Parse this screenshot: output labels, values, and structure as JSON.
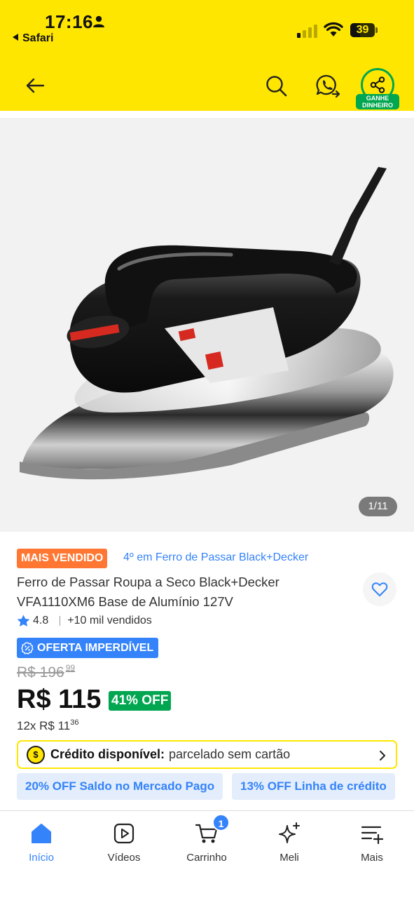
{
  "status_bar": {
    "time": "17:16",
    "back_app": "Safari",
    "battery": 39
  },
  "header": {
    "back_icon": "arrow-left-icon",
    "search_icon": "search-icon",
    "whatsapp_icon": "whatsapp-share-icon",
    "share_icon": "share-icon",
    "share_tag": "GANHE DINHEIRO"
  },
  "gallery": {
    "counter": "1/11"
  },
  "product": {
    "best_seller_badge": "MAIS VENDIDO",
    "ranking_link": "4º em Ferro de Passar Black+Decker",
    "title": "Ferro de Passar Roupa a Seco Black+Decker VFA1110XM6 Base de Alumínio 127V",
    "rating": "4.8",
    "sold": "+10 mil vendidos",
    "deal_badge": "OFERTA IMPERDÍVEL",
    "old_price_main": "R$ 196",
    "old_price_cents": "99",
    "price": "R$ 115",
    "discount": "41% OFF",
    "installments_main": "12x R$ 11",
    "installments_cents": "36"
  },
  "credit": {
    "coin": "$",
    "strong": "Crédito disponível:",
    "rest": "parcelado sem cartão"
  },
  "promos": [
    "20% OFF Saldo no Mercado Pago",
    "13% OFF Linha de crédito"
  ],
  "bottom_nav": [
    {
      "label": "Início",
      "icon": "home-icon",
      "active": true
    },
    {
      "label": "Vídeos",
      "icon": "video-play-icon",
      "active": false
    },
    {
      "label": "Carrinho",
      "icon": "cart-icon",
      "active": false,
      "badge": "1"
    },
    {
      "label": "Meli",
      "icon": "sparkle-icon",
      "active": false
    },
    {
      "label": "Mais",
      "icon": "menu-plus-icon",
      "active": false
    }
  ],
  "colors": {
    "brand_yellow": "#ffe600",
    "accent_blue": "#3483fa",
    "green": "#00a650",
    "orange": "#ff7733"
  }
}
